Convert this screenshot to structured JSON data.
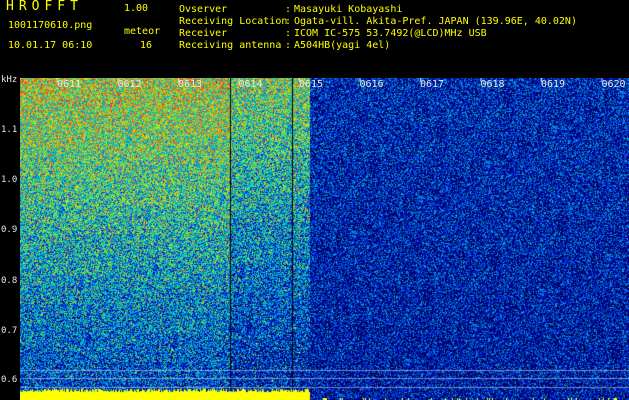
{
  "app": {
    "name": "HROFFT",
    "version": "1.00"
  },
  "file": {
    "name": "1001170610.png",
    "datetime": "10.01.17 06:10"
  },
  "meteor": {
    "label": "meteor",
    "count": "16"
  },
  "station": [
    {
      "label": "Ovserver",
      "value": "Masayuki Kobayashi"
    },
    {
      "label": "Receiving Location",
      "value": "Ogata-vill. Akita-Pref. JAPAN (139.96E, 40.02N)"
    },
    {
      "label": "Receiver",
      "value": "ICOM IC-575 53.7492(@LCD)MHz USB"
    },
    {
      "label": "Receiving antenna",
      "value": "A504HB(yagi 4el)"
    }
  ],
  "colon": ":",
  "axis": {
    "unit": "kHz",
    "x_ticks": [
      "0611",
      "0612",
      "0613",
      "0614",
      "0615",
      "0616",
      "0617",
      "0618",
      "0619",
      "0620"
    ],
    "y_ticks": [
      "1.1",
      "1.0",
      "0.9",
      "0.8",
      "0.7",
      "0.6"
    ]
  },
  "colors": {
    "header_text": "#ffff00",
    "label_text": "#e8e8e8",
    "background": "#000000",
    "signal": "#ffff00"
  }
}
